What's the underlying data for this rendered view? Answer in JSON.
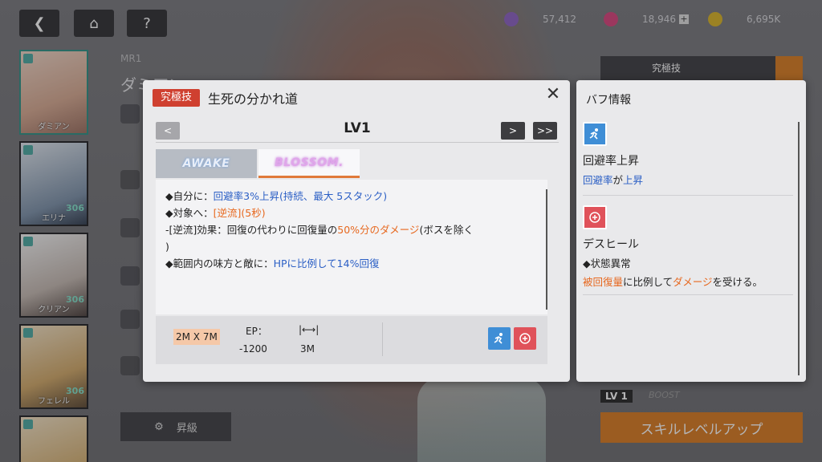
{
  "top": {
    "back_label": "❮",
    "home_label": "⌂",
    "help_label": "?",
    "currency1": "57,412",
    "currency2": "18,946",
    "currency3": "6,695K",
    "plus": "+"
  },
  "characters": [
    {
      "name": "ダミアン",
      "level": ""
    },
    {
      "name": "エリナ",
      "level": "306"
    },
    {
      "name": "クリアン",
      "level": "306"
    },
    {
      "name": "フェレル",
      "level": "306"
    },
    {
      "name": "",
      "level": "306"
    }
  ],
  "bg": {
    "mr_label": "MR1",
    "char_name": "ダミアン",
    "upgrade_label": "昇級",
    "skill_up_label": "スキルレベルアップ",
    "ultimate_tag": "究極技",
    "lv_badge": "LV 1",
    "boost_label": "BOOST"
  },
  "dialog": {
    "badge": "究極技",
    "title": "生死の分かれ道",
    "level": "LV1",
    "prev": "<",
    "next": ">",
    "max": ">>",
    "tabs": [
      "AWAKE",
      "BLOSSOM."
    ],
    "lines": {
      "l1a": "◆自分に：",
      "l1b": "回避率3%上昇(持続、最大 5スタック)",
      "l2a": "◆対象へ：",
      "l2b": "[逆流](5秒)",
      "l3a": "-[逆流]効果：回復の代わりに回復量の",
      "l3b": "50%分のダメージ",
      "l3c": "(ボスを除く",
      "l4": ")",
      "l5a": "◆範囲内の味方と敵に：",
      "l5b": "HPに比例して14%回復"
    },
    "range": "2M X 7M",
    "ep_label": "EP：",
    "ep_value": "-1200",
    "distance_icon": "|⟷|",
    "distance_value": "3M"
  },
  "buff_panel": {
    "title": "バフ情報",
    "items": [
      {
        "name": "回避率上昇",
        "desc_a": "回避率",
        "desc_b": "が",
        "desc_c": "上昇"
      },
      {
        "name": "デスヒール",
        "sub": "◆状態異常",
        "desc_a": "被回復量",
        "desc_b": "に比例して",
        "desc_c": "ダメージ",
        "desc_d": "を受ける。"
      }
    ]
  },
  "colors": {
    "accent_orange": "#e7681f",
    "accent_blue": "#2b5fc5",
    "ultimate_red": "#cf4030"
  }
}
